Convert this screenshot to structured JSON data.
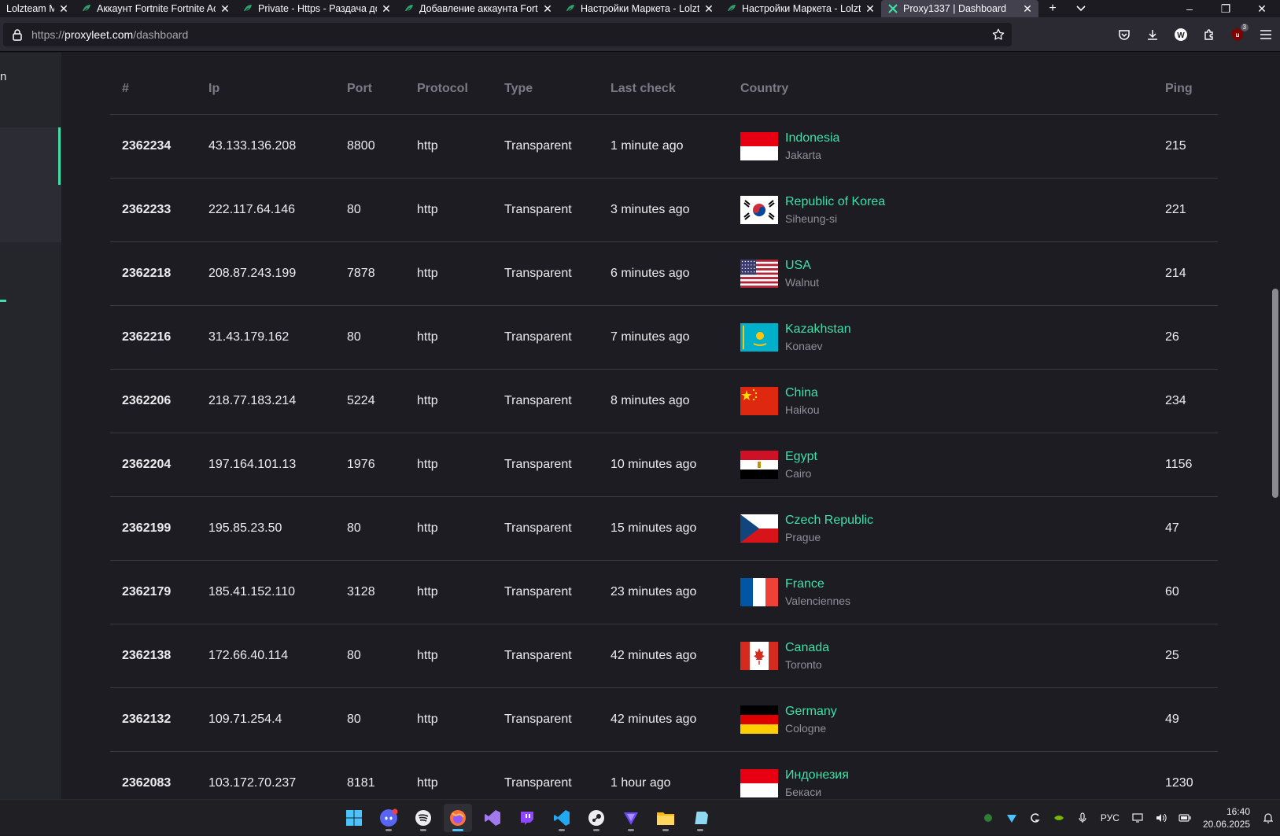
{
  "browser": {
    "tabs": [
      {
        "title": "Lolzteam Ma",
        "active": false,
        "icon": "lolz-icon"
      },
      {
        "title": "Аккаунт Fortnite Fortnite Acc",
        "active": false,
        "icon": "lolz-icon"
      },
      {
        "title": "Private - Https - Раздача дос",
        "active": false,
        "icon": "lolz-icon"
      },
      {
        "title": "Добавление аккаунта Fortni",
        "active": false,
        "icon": "lolz-icon"
      },
      {
        "title": "Настройки Маркета - Lolzte",
        "active": false,
        "icon": "lolz-icon"
      },
      {
        "title": "Настройки Маркета - Lolzte",
        "active": false,
        "icon": "lolz-icon"
      },
      {
        "title": "Proxy1337 | Dashboard",
        "active": true,
        "icon": "proxy1337-icon"
      }
    ],
    "url": {
      "scheme": "https://",
      "host": "proxyleet.com",
      "path": "/dashboard"
    },
    "ublock_badge": "3"
  },
  "sidebar": {
    "letter": "n"
  },
  "table": {
    "headers": {
      "id": "#",
      "ip": "Ip",
      "port": "Port",
      "protocol": "Protocol",
      "type": "Type",
      "last_check": "Last check",
      "country": "Country",
      "ping": "Ping"
    },
    "rows": [
      {
        "id": "2362234",
        "ip": "43.133.136.208",
        "port": "8800",
        "protocol": "http",
        "type": "Transparent",
        "last_check": "1 minute ago",
        "country": "Indonesia",
        "city": "Jakarta",
        "flag": "id",
        "ping": "215"
      },
      {
        "id": "2362233",
        "ip": "222.117.64.146",
        "port": "80",
        "protocol": "http",
        "type": "Transparent",
        "last_check": "3 minutes ago",
        "country": "Republic of Korea",
        "city": "Siheung-si",
        "flag": "kr",
        "ping": "221"
      },
      {
        "id": "2362218",
        "ip": "208.87.243.199",
        "port": "7878",
        "protocol": "http",
        "type": "Transparent",
        "last_check": "6 minutes ago",
        "country": "USA",
        "city": "Walnut",
        "flag": "us",
        "ping": "214"
      },
      {
        "id": "2362216",
        "ip": "31.43.179.162",
        "port": "80",
        "protocol": "http",
        "type": "Transparent",
        "last_check": "7 minutes ago",
        "country": "Kazakhstan",
        "city": "Konaev",
        "flag": "kz",
        "ping": "26"
      },
      {
        "id": "2362206",
        "ip": "218.77.183.214",
        "port": "5224",
        "protocol": "http",
        "type": "Transparent",
        "last_check": "8 minutes ago",
        "country": "China",
        "city": "Haikou",
        "flag": "cn",
        "ping": "234"
      },
      {
        "id": "2362204",
        "ip": "197.164.101.13",
        "port": "1976",
        "protocol": "http",
        "type": "Transparent",
        "last_check": "10 minutes ago",
        "country": "Egypt",
        "city": "Cairo",
        "flag": "eg",
        "ping": "1156"
      },
      {
        "id": "2362199",
        "ip": "195.85.23.50",
        "port": "80",
        "protocol": "http",
        "type": "Transparent",
        "last_check": "15 minutes ago",
        "country": "Czech Republic",
        "city": "Prague",
        "flag": "cz",
        "ping": "47"
      },
      {
        "id": "2362179",
        "ip": "185.41.152.110",
        "port": "3128",
        "protocol": "http",
        "type": "Transparent",
        "last_check": "23 minutes ago",
        "country": "France",
        "city": "Valenciennes",
        "flag": "fr",
        "ping": "60"
      },
      {
        "id": "2362138",
        "ip": "172.66.40.114",
        "port": "80",
        "protocol": "http",
        "type": "Transparent",
        "last_check": "42 minutes ago",
        "country": "Canada",
        "city": "Toronto",
        "flag": "ca",
        "ping": "25"
      },
      {
        "id": "2362132",
        "ip": "109.71.254.4",
        "port": "80",
        "protocol": "http",
        "type": "Transparent",
        "last_check": "42 minutes ago",
        "country": "Germany",
        "city": "Cologne",
        "flag": "de",
        "ping": "49"
      },
      {
        "id": "2362083",
        "ip": "103.172.70.237",
        "port": "8181",
        "protocol": "http",
        "type": "Transparent",
        "last_check": "1 hour ago",
        "country": "Индонезия",
        "city": "Бекаси",
        "flag": "id",
        "ping": "1230"
      }
    ]
  },
  "taskbar": {
    "apps": [
      "windows-start-icon",
      "discord-icon",
      "spotify-icon",
      "firefox-icon",
      "visual-studio-icon",
      "twitch-icon",
      "vscode-icon",
      "steam-icon",
      "proton-vpn-icon",
      "file-explorer-icon",
      "notepad-icon"
    ],
    "active_app": "firefox-icon",
    "language": "РУС",
    "time": "16:40",
    "date": "20.06.2025"
  },
  "colors": {
    "accent": "#3fe0a8",
    "background": "#1c1c22",
    "muted": "#7b7b84"
  }
}
